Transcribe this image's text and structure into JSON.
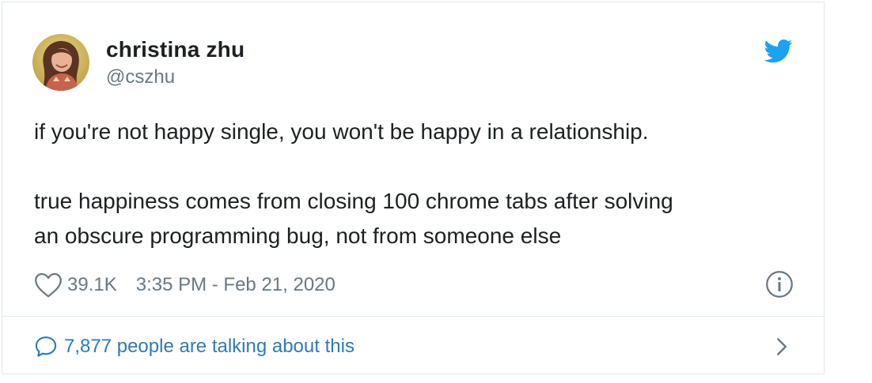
{
  "author": {
    "display_name": "christina zhu",
    "handle": "@cszhu",
    "avatar_icon": "avatar-photo"
  },
  "brand": {
    "icon": "twitter-bird-icon",
    "color": "#1da1f2"
  },
  "tweet": {
    "paragraphs": [
      "if you're not happy single, you won't be happy in a relationship.",
      "true happiness comes from closing 100 chrome tabs after solving",
      "an obscure programming bug, not from someone else"
    ]
  },
  "meta": {
    "likes": "39.1K",
    "timestamp": "3:35 PM - Feb 21, 2020",
    "like_icon": "heart-icon",
    "info_icon": "info-icon"
  },
  "conversation": {
    "label": "7,877 people are talking about this",
    "bubble_icon": "speech-bubble-icon",
    "chevron_icon": "chevron-right-icon",
    "color": "#2b7bb9"
  },
  "colors": {
    "text": "#1c2022",
    "secondary": "#697882",
    "border": "#e1e8ed"
  }
}
